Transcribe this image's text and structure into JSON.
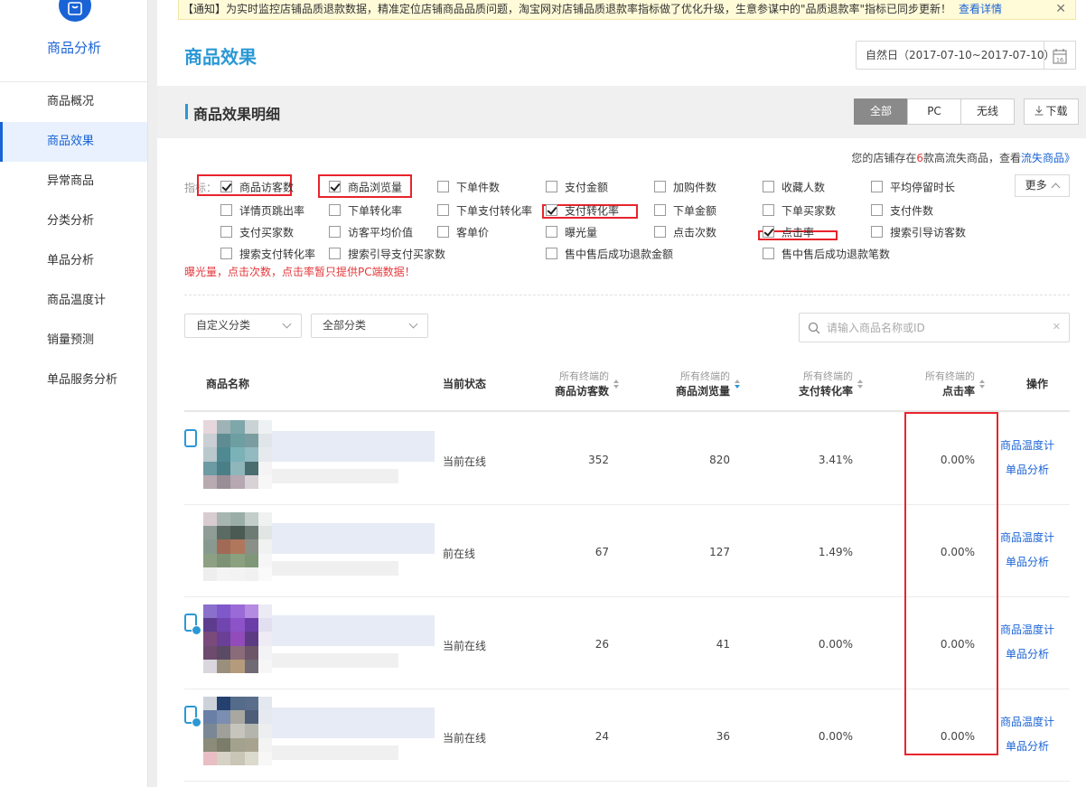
{
  "sidebar": {
    "title": "商品分析",
    "items": [
      {
        "label": "商品概况"
      },
      {
        "label": "商品效果"
      },
      {
        "label": "异常商品"
      },
      {
        "label": "分类分析"
      },
      {
        "label": "单品分析"
      },
      {
        "label": "商品温度计"
      },
      {
        "label": "销量预测"
      },
      {
        "label": "单品服务分析"
      }
    ]
  },
  "notice": {
    "text": "【通知】为实时监控店铺品质退款数据，精准定位店铺商品品质问题，淘宝网对店铺品质退款率指标做了优化升级，生意参谋中的\"品质退款率\"指标已同步更新！",
    "link": "查看详情",
    "close": "✕"
  },
  "header": {
    "title": "商品效果",
    "date_range": "自然日（2017-07-10~2017-07-10）",
    "calendar_day": "16"
  },
  "panel": {
    "title": "商品效果明细",
    "segments": [
      "全部",
      "PC",
      "无线"
    ],
    "download": "下载",
    "loss_note_prefix": "您的店铺存在",
    "loss_note_count": "6",
    "loss_note_mid": "款高流失商品，查看",
    "loss_note_link": "流失商品》"
  },
  "metrics": {
    "label": "指标：",
    "more": "更多",
    "warning": "曝光量，点击次数，点击率暂只提供PC端数据！",
    "items": [
      {
        "label": "商品访客数",
        "checked": true
      },
      {
        "label": "商品浏览量",
        "checked": true
      },
      {
        "label": "下单件数",
        "checked": false
      },
      {
        "label": "支付金额",
        "checked": false
      },
      {
        "label": "加购件数",
        "checked": false
      },
      {
        "label": "收藏人数",
        "checked": false
      },
      {
        "label": "平均停留时长",
        "checked": false
      },
      {
        "label": "详情页跳出率",
        "checked": false
      },
      {
        "label": "下单转化率",
        "checked": false
      },
      {
        "label": "下单支付转化率",
        "checked": false
      },
      {
        "label": "支付转化率",
        "checked": true
      },
      {
        "label": "下单金额",
        "checked": false
      },
      {
        "label": "下单买家数",
        "checked": false
      },
      {
        "label": "支付件数",
        "checked": false
      },
      {
        "label": "支付买家数",
        "checked": false
      },
      {
        "label": "访客平均价值",
        "checked": false
      },
      {
        "label": "客单价",
        "checked": false
      },
      {
        "label": "曝光量",
        "checked": false
      },
      {
        "label": "点击次数",
        "checked": false
      },
      {
        "label": "点击率",
        "checked": true
      },
      {
        "label": "搜索引导访客数",
        "checked": false
      },
      {
        "label": "搜索支付转化率",
        "checked": false
      },
      {
        "label": "搜索引导支付买家数",
        "checked": false
      },
      {
        "label": "售中售后成功退款金额",
        "checked": false
      },
      {
        "label": "售中售后成功退款笔数",
        "checked": false
      }
    ]
  },
  "filters": {
    "custom_category": "自定义分类",
    "all_category": "全部分类",
    "search_placeholder": "请输入商品名称或ID",
    "search_clear": "✕"
  },
  "table": {
    "headers": {
      "name": "商品名称",
      "status": "当前状态",
      "terminal": "所有终端的",
      "visitors": "商品访客数",
      "pageviews": "商品浏览量",
      "pay_rate": "支付转化率",
      "click_rate": "点击率",
      "action": "操作"
    },
    "rows": [
      {
        "status": "当前在线",
        "visitors": "352",
        "pageviews": "820",
        "pay_rate": "3.41%",
        "click_rate": "0.00%",
        "op1": "商品温度计",
        "op2": "单品分析"
      },
      {
        "status": "前在线",
        "visitors": "67",
        "pageviews": "127",
        "pay_rate": "1.49%",
        "click_rate": "0.00%",
        "op1": "商品温度计",
        "op2": "单品分析"
      },
      {
        "status": "当前在线",
        "visitors": "26",
        "pageviews": "41",
        "pay_rate": "0.00%",
        "click_rate": "0.00%",
        "op1": "商品温度计",
        "op2": "单品分析"
      },
      {
        "status": "当前在线",
        "visitors": "24",
        "pageviews": "36",
        "pay_rate": "0.00%",
        "click_rate": "0.00%",
        "op1": "商品温度计",
        "op2": "单品分析"
      }
    ]
  },
  "colors": {
    "accent": "#2b98d5",
    "link": "#1a63d6",
    "highlight_box": "#e8242c",
    "warning": "#e4393c"
  }
}
